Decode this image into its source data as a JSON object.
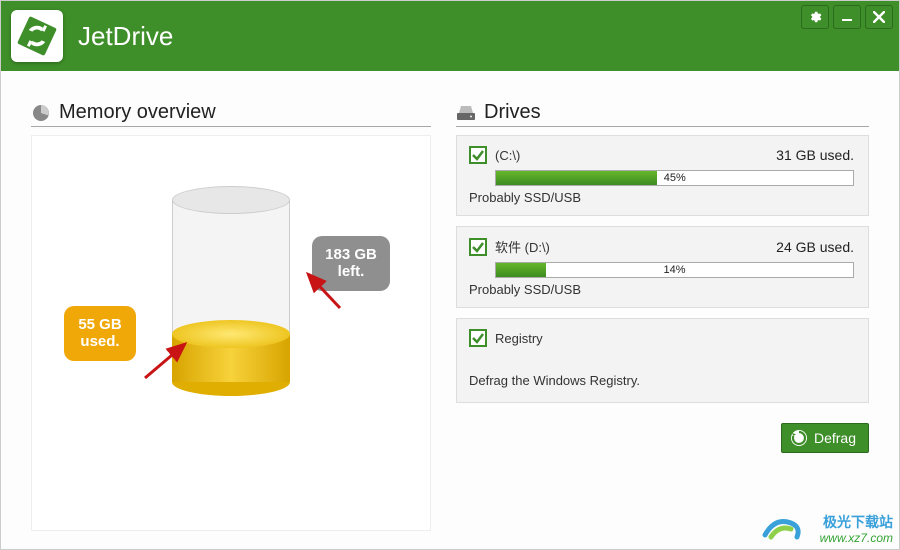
{
  "app": {
    "title": "JetDrive"
  },
  "sections": {
    "memory_title": "Memory overview",
    "drives_title": "Drives"
  },
  "memory": {
    "used_label": "55 GB used.",
    "left_label": "183 GB left."
  },
  "drives": [
    {
      "name": "(C:\\)",
      "used_text": "31 GB used.",
      "percent_text": "45%",
      "percent": 45,
      "note": "Probably SSD/USB"
    },
    {
      "name": "软件 (D:\\)",
      "used_text": "24 GB used.",
      "percent_text": "14%",
      "percent": 14,
      "note": "Probably SSD/USB"
    }
  ],
  "registry": {
    "label": "Registry",
    "note": "Defrag the Windows Registry."
  },
  "actions": {
    "defrag": "Defrag"
  },
  "watermark": {
    "line1": "极光下载站",
    "line2": "www.xz7.com"
  }
}
